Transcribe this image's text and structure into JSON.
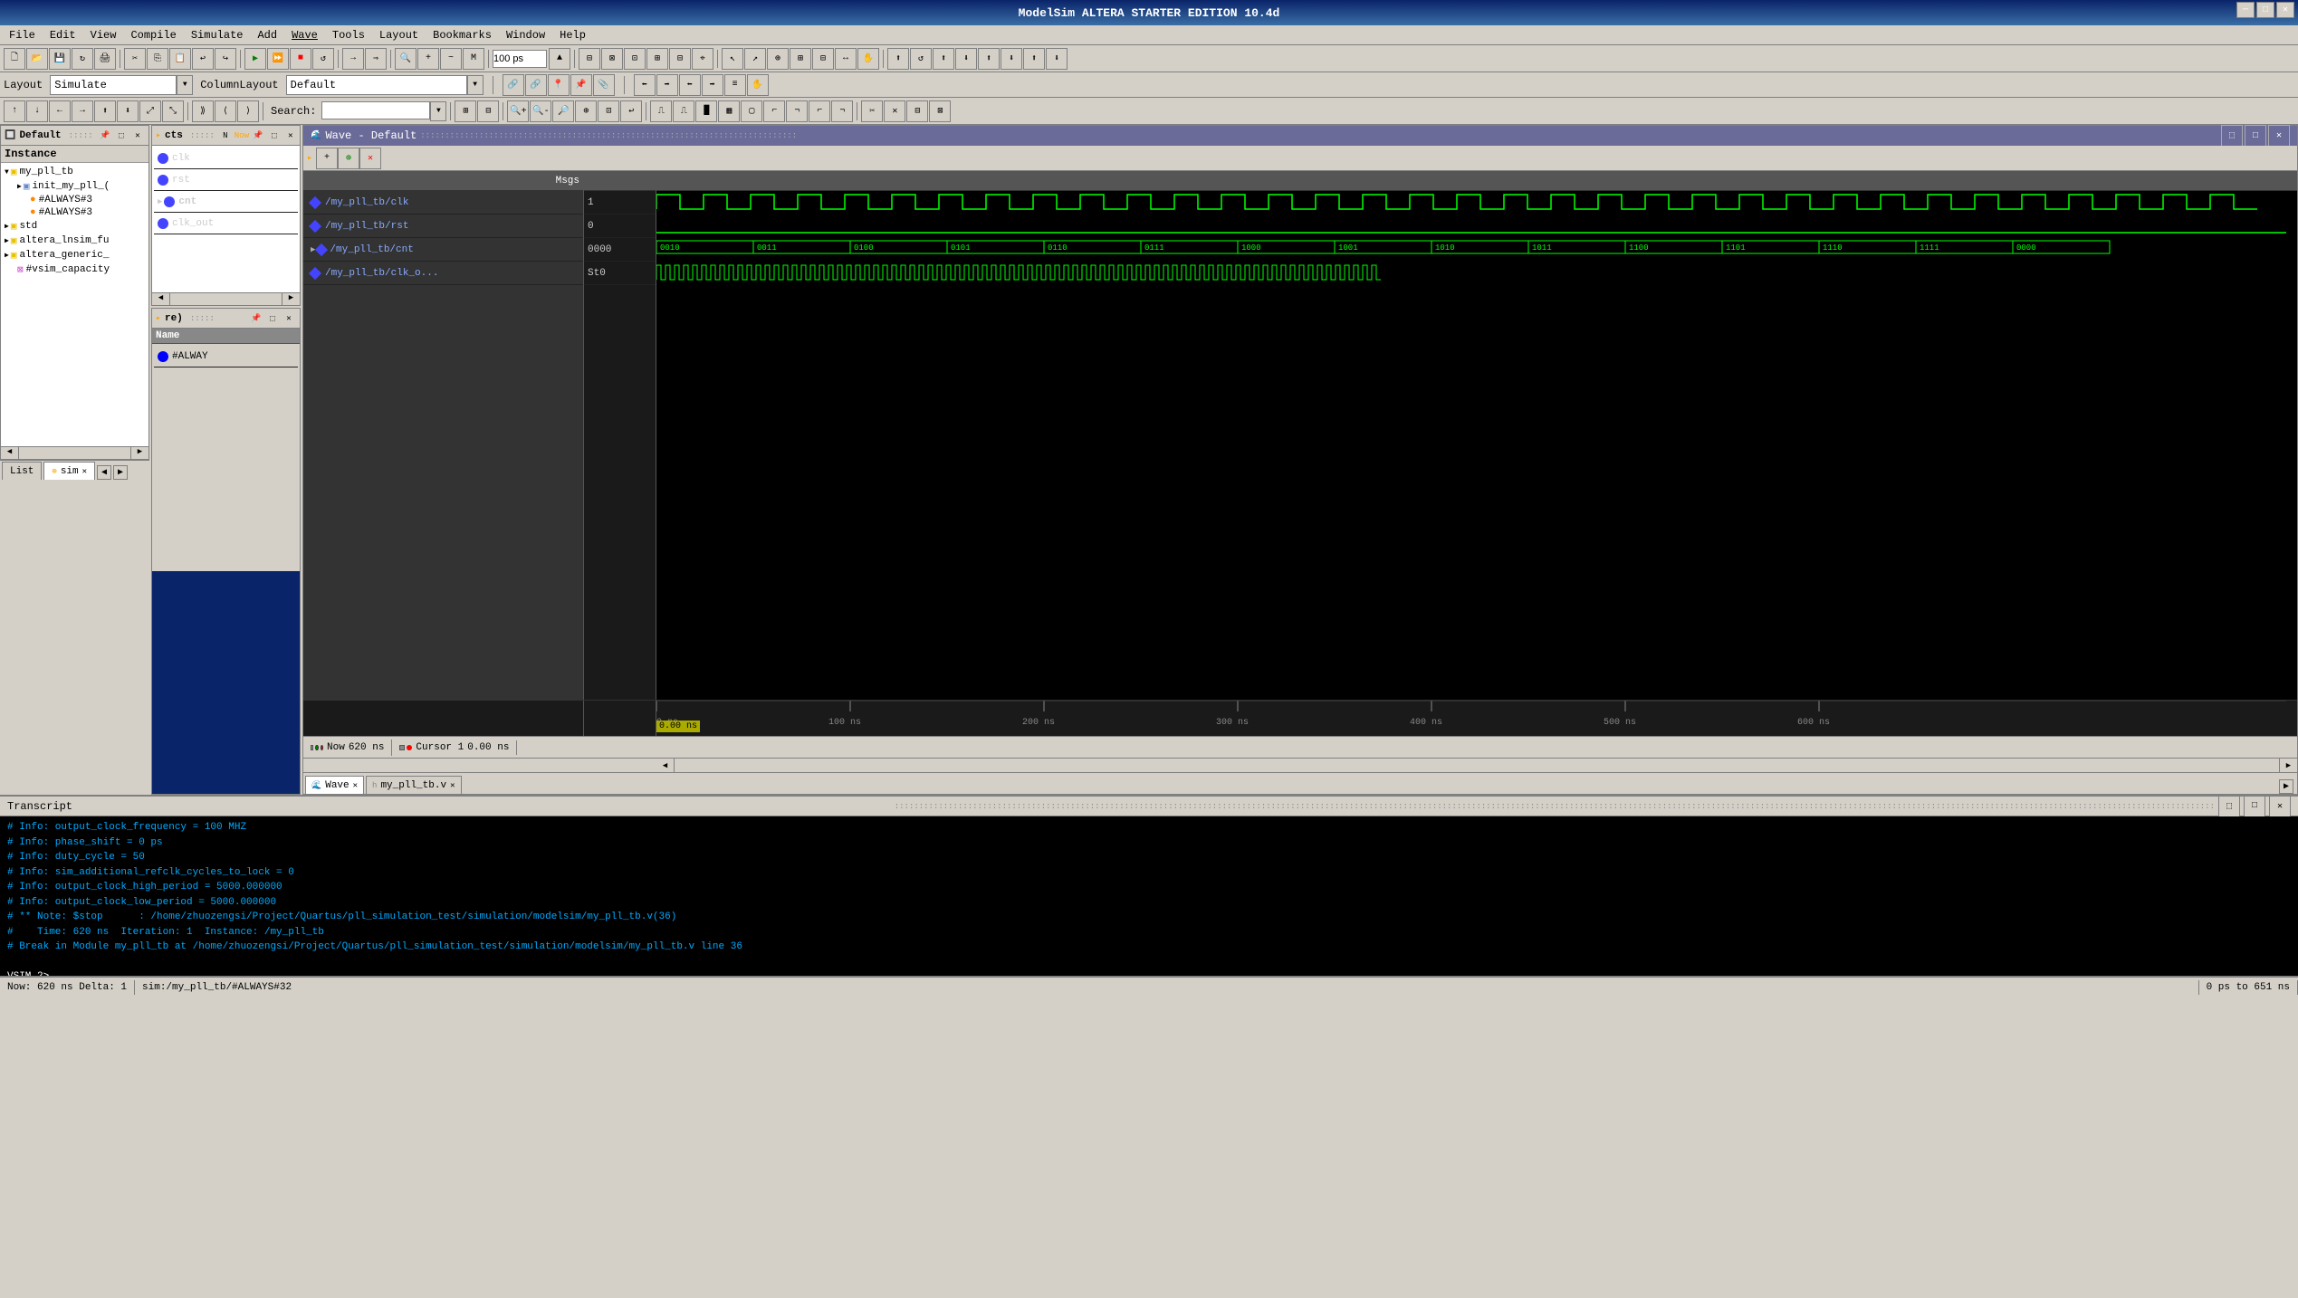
{
  "window": {
    "title": "ModelSim ALTERA STARTER EDITION 10.4d",
    "controls": [
      "minimize",
      "maximize",
      "close"
    ]
  },
  "menu": {
    "items": [
      "File",
      "Edit",
      "View",
      "Compile",
      "Simulate",
      "Add",
      "Wave",
      "Tools",
      "Layout",
      "Bookmarks",
      "Window",
      "Help"
    ]
  },
  "layout_bar": {
    "layout_label": "Layout",
    "layout_value": "Simulate",
    "column_layout_label": "ColumnLayout",
    "column_layout_value": "Default"
  },
  "search_bar": {
    "label": "Search:",
    "placeholder": ""
  },
  "panels": {
    "default": {
      "title": "Default",
      "instance_section": {
        "label": "Instance",
        "items": [
          {
            "name": "my_pll_tb",
            "type": "folder",
            "level": 0,
            "expanded": true
          },
          {
            "name": "init_my_pll_(",
            "type": "module",
            "level": 1,
            "expanded": false
          },
          {
            "name": "#ALWAYS#3",
            "type": "signal",
            "level": 1
          },
          {
            "name": "#ALWAYS#3",
            "type": "signal",
            "level": 1
          },
          {
            "name": "std",
            "type": "folder",
            "level": 0
          },
          {
            "name": "altera_lnsim_fu",
            "type": "folder",
            "level": 0
          },
          {
            "name": "altera_generic_",
            "type": "folder",
            "level": 0
          },
          {
            "name": "#vsim_capacity",
            "type": "special",
            "level": 0
          }
        ]
      }
    },
    "objects": {
      "title": "cts",
      "signals": [
        {
          "name": "clk",
          "type": "signal"
        },
        {
          "name": "rst",
          "type": "signal"
        },
        {
          "name": "cnt",
          "type": "bus",
          "expanded": true
        },
        {
          "name": "clk_out",
          "type": "signal"
        }
      ]
    },
    "events": {
      "title": "re)",
      "columns": [
        "Name"
      ],
      "items": [
        {
          "name": "#ALWAY",
          "type": "event"
        }
      ]
    }
  },
  "wave": {
    "title": "Wave - Default",
    "signals": [
      {
        "path": "/my_pll_tb/clk",
        "value": "1"
      },
      {
        "path": "/my_pll_tb/rst",
        "value": "0"
      },
      {
        "path": "/my_pll_tb/cnt",
        "value": "0000",
        "expanded": true
      },
      {
        "path": "/my_pll_tb/clk_o...",
        "value": "St0"
      }
    ],
    "now": "620 ns",
    "cursor1": "0.00 ns",
    "timeline": {
      "markers": [
        "0 ns",
        "100 ns",
        "200 ns",
        "300 ns",
        "400 ns",
        "500 ns",
        "600 ns"
      ]
    },
    "cnt_values": [
      "0010",
      "0011",
      "0100",
      "0101",
      "0110",
      "0111",
      "1000",
      "1001",
      "1010",
      "1011",
      "1100",
      "1101",
      "1110",
      "1111",
      "0000"
    ]
  },
  "tabs": {
    "wave_tabs": [
      {
        "label": "Wave",
        "active": true,
        "closeable": true,
        "icon": "wave"
      },
      {
        "label": "my_pll_tb.v",
        "active": false,
        "closeable": true,
        "icon": "file"
      }
    ],
    "bottom_tabs": [
      {
        "label": "List",
        "active": false
      },
      {
        "label": "sim",
        "active": true,
        "closeable": true
      }
    ]
  },
  "transcript": {
    "title": "Transcript",
    "lines": [
      {
        "text": "# Info: output_clock_frequency = 100 MHZ",
        "class": "t-blue"
      },
      {
        "text": "# Info: phase_shift = 0 ps",
        "class": "t-blue"
      },
      {
        "text": "# Info: duty_cycle = 50",
        "class": "t-blue"
      },
      {
        "text": "# Info: sim_additional_refclk_cycles_to_lock = 0",
        "class": "t-blue"
      },
      {
        "text": "# Info: output_clock_high_period = 5000.000000",
        "class": "t-blue"
      },
      {
        "text": "# Info: output_clock_low_period = 5000.000000",
        "class": "t-blue"
      },
      {
        "text": "# ** Note: $stop      : /home/zhuozengsi/Project/Quartus/pll_simulation_test/simulation/modelsim/my_pll_tb.v(36)",
        "class": "t-blue"
      },
      {
        "text": "#    Time: 620 ns  Iteration: 1  Instance: /my_pll_tb",
        "class": "t-blue"
      },
      {
        "text": "# Break in Module my_pll_tb at /home/zhuozengsi/Project/Quartus/pll_simulation_test/simulation/modelsim/my_pll_tb.v line 36",
        "class": "t-blue"
      },
      {
        "text": "",
        "class": ""
      },
      {
        "text": "VSIM 2>",
        "class": "t-white"
      }
    ]
  },
  "status_bar": {
    "now": "Now: 620 ns  Delta: 1",
    "instance": "sim:/my_pll_tb/#ALWAYS#32",
    "time_range": "0 ps to 651 ns"
  }
}
